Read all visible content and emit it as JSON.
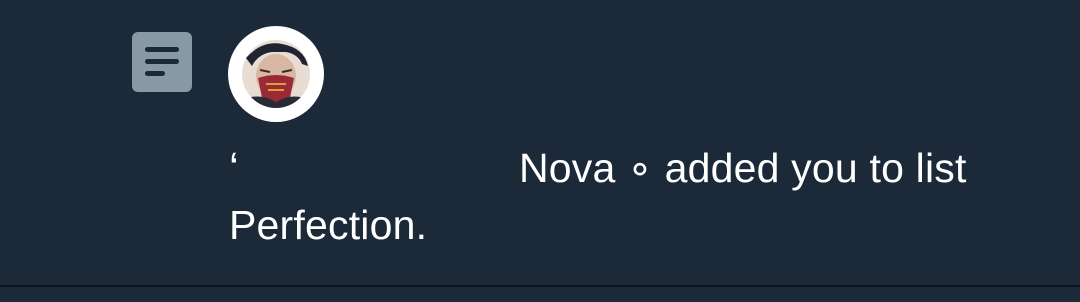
{
  "notification": {
    "prefix_mark": "‘",
    "display_name": "Nova ∘",
    "action_text": " added you to list ",
    "list_name": "Perfection",
    "suffix": "."
  },
  "colors": {
    "background": "#1c2938",
    "list_icon_bg": "#8899a6",
    "text": "#ffffff"
  },
  "icons": {
    "list": "list-icon",
    "avatar": "user-avatar"
  }
}
